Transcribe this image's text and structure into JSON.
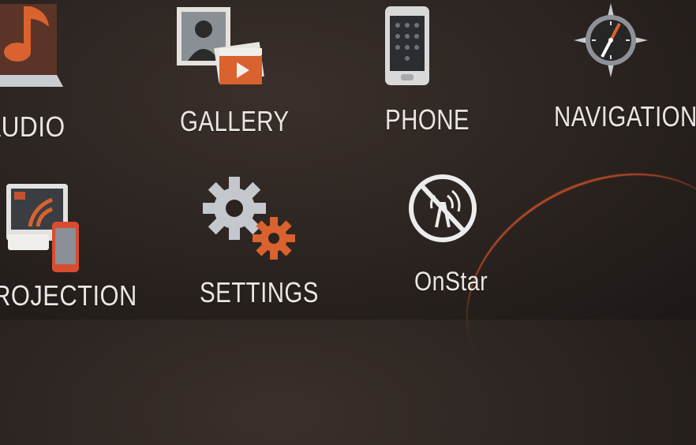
{
  "home_menu": {
    "items": [
      {
        "label": "AUDIO",
        "icon": "music-note-icon"
      },
      {
        "label": "GALLERY",
        "icon": "gallery-icon"
      },
      {
        "label": "PHONE",
        "icon": "phone-icon"
      },
      {
        "label": "NAVIGATION",
        "icon": "compass-icon"
      },
      {
        "label": "PROJECTION",
        "icon": "projection-icon"
      },
      {
        "label": "SETTINGS",
        "icon": "gears-icon"
      },
      {
        "label": "OnStar",
        "icon": "onstar-icon"
      }
    ]
  },
  "colors": {
    "background": "#2a2320",
    "label": "#e9e6e4",
    "accent": "#d2532a"
  }
}
